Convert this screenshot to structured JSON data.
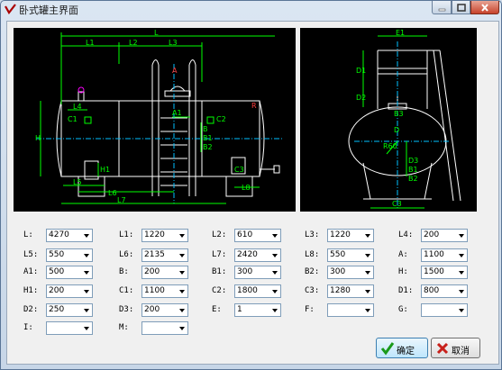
{
  "window": {
    "title": "卧式罐主界面"
  },
  "buttons": {
    "ok": "确定",
    "cancel": "取消"
  },
  "front_view": {
    "dims": [
      "L",
      "L1",
      "L2",
      "L3",
      "L4",
      "L5",
      "L6",
      "L7",
      "L8",
      "A",
      "A1",
      "H",
      "H1",
      "B",
      "B1",
      "B2",
      "C1",
      "C2",
      "C3",
      "R"
    ]
  },
  "side_view": {
    "dims": [
      "E1",
      "D1",
      "D2",
      "D3",
      "B1",
      "B2",
      "B3",
      "C3",
      "R60",
      "D"
    ]
  },
  "params": [
    {
      "label": "L:",
      "value": "4270"
    },
    {
      "label": "L1:",
      "value": "1220"
    },
    {
      "label": "L2:",
      "value": "610"
    },
    {
      "label": "L3:",
      "value": "1220"
    },
    {
      "label": "L4:",
      "value": "200"
    },
    {
      "label": "L5:",
      "value": "550"
    },
    {
      "label": "L6:",
      "value": "2135"
    },
    {
      "label": "L7:",
      "value": "2420"
    },
    {
      "label": "L8:",
      "value": "550"
    },
    {
      "label": "A:",
      "value": "1100"
    },
    {
      "label": "A1:",
      "value": "500"
    },
    {
      "label": "B:",
      "value": "200"
    },
    {
      "label": "B1:",
      "value": "300"
    },
    {
      "label": "B2:",
      "value": "300"
    },
    {
      "label": "H:",
      "value": "1500"
    },
    {
      "label": "H1:",
      "value": "200"
    },
    {
      "label": "C1:",
      "value": "1100"
    },
    {
      "label": "C2:",
      "value": "1800"
    },
    {
      "label": "C3:",
      "value": "1280"
    },
    {
      "label": "D1:",
      "value": "800"
    },
    {
      "label": "D2:",
      "value": "250"
    },
    {
      "label": "D3:",
      "value": "200"
    },
    {
      "label": "E:",
      "value": "1"
    },
    {
      "label": "F:",
      "value": ""
    },
    {
      "label": "G:",
      "value": ""
    },
    {
      "label": "I:",
      "value": ""
    },
    {
      "label": "M:",
      "value": ""
    }
  ],
  "colors": {
    "drawing_bg": "#000000",
    "tank": "#ffffff",
    "dimension": "#00ff00",
    "axis": "#00bfff",
    "accent": "#ff4040"
  }
}
